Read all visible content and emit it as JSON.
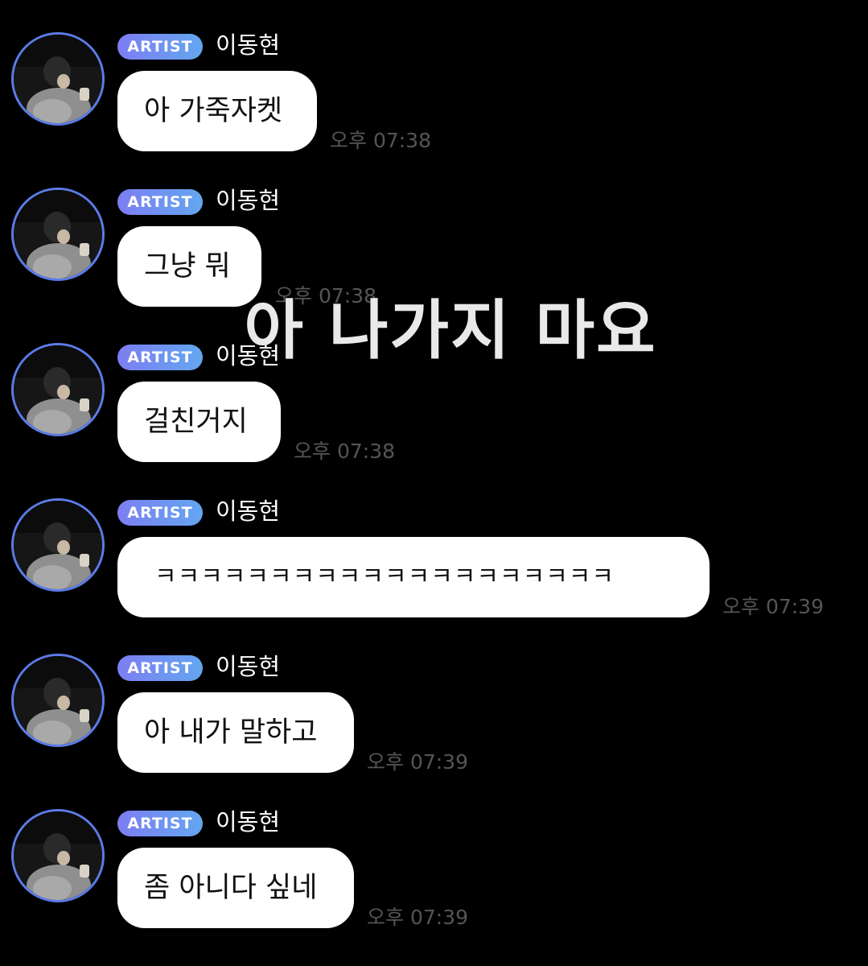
{
  "messages": [
    {
      "badge": "ARTIST",
      "sender": "이동현",
      "text": "아 가죽자켓",
      "time": "오후 07:38"
    },
    {
      "badge": "ARTIST",
      "sender": "이동현",
      "text": "그냥 뭐",
      "time": "오후 07:38"
    },
    {
      "badge": "ARTIST",
      "sender": "이동현",
      "text": "걸친거지",
      "time": "오후 07:38"
    },
    {
      "badge": "ARTIST",
      "sender": "이동현",
      "text": "ㅋㅋㅋㅋㅋㅋㅋㅋㅋㅋㅋㅋㅋㅋㅋㅋㅋㅋㅋㅋ",
      "time": "오후 07:39"
    },
    {
      "badge": "ARTIST",
      "sender": "이동현",
      "text": "아 내가 말하고",
      "time": "오후 07:39"
    },
    {
      "badge": "ARTIST",
      "sender": "이동현",
      "text": "좀 아니다 싶네",
      "time": "오후 07:39"
    }
  ],
  "overlay": {
    "caption": "아 나가지 마요"
  },
  "colors": {
    "background": "#000000",
    "bubble": "#ffffff",
    "badge_start": "#7d7ef2",
    "badge_end": "#63a6f0",
    "avatar_ring": "#5b7ce8",
    "time": "#555555"
  }
}
